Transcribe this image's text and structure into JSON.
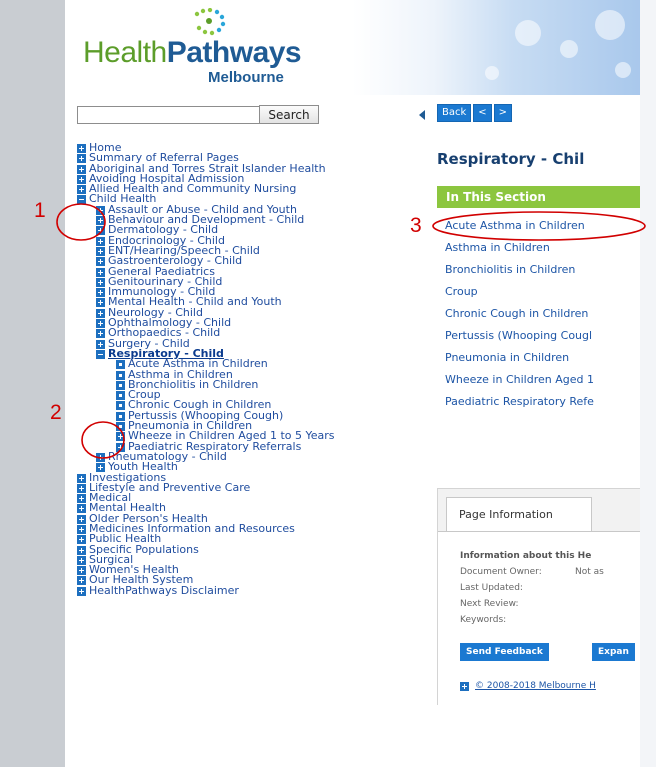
{
  "header": {
    "logo_health": "Health",
    "logo_pathways": "Pathways",
    "logo_region": "Melbourne"
  },
  "search": {
    "value": "",
    "button_label": "Search"
  },
  "nav_buttons": {
    "back": "Back",
    "prev": "<",
    "next": ">"
  },
  "tree": [
    {
      "label": "Home",
      "level": 1,
      "icon": "plus"
    },
    {
      "label": "Summary of Referral Pages",
      "level": 1,
      "icon": "plus"
    },
    {
      "label": "Aboriginal and Torres Strait Islander Health",
      "level": 1,
      "icon": "plus"
    },
    {
      "label": "Avoiding Hospital Admission",
      "level": 1,
      "icon": "plus"
    },
    {
      "label": "Allied Health and Community Nursing",
      "level": 1,
      "icon": "plus"
    },
    {
      "label": "Child Health",
      "level": 1,
      "icon": "minus"
    },
    {
      "label": "Assault or Abuse - Child and Youth",
      "level": 2,
      "icon": "plus"
    },
    {
      "label": "Behaviour and Development - Child",
      "level": 2,
      "icon": "plus"
    },
    {
      "label": "Dermatology - Child",
      "level": 2,
      "icon": "plus"
    },
    {
      "label": "Endocrinology - Child",
      "level": 2,
      "icon": "plus"
    },
    {
      "label": "ENT/Hearing/Speech - Child",
      "level": 2,
      "icon": "plus"
    },
    {
      "label": "Gastroenterology - Child",
      "level": 2,
      "icon": "plus"
    },
    {
      "label": "General Paediatrics",
      "level": 2,
      "icon": "plus"
    },
    {
      "label": "Genitourinary - Child",
      "level": 2,
      "icon": "plus"
    },
    {
      "label": "Immunology - Child",
      "level": 2,
      "icon": "plus"
    },
    {
      "label": "Mental Health - Child and Youth",
      "level": 2,
      "icon": "plus"
    },
    {
      "label": "Neurology - Child",
      "level": 2,
      "icon": "plus"
    },
    {
      "label": "Ophthalmology - Child",
      "level": 2,
      "icon": "plus"
    },
    {
      "label": "Orthopaedics - Child",
      "level": 2,
      "icon": "plus"
    },
    {
      "label": "Surgery - Child",
      "level": 2,
      "icon": "plus"
    },
    {
      "label": "Respiratory - Child",
      "level": 2,
      "icon": "minus",
      "current": true
    },
    {
      "label": "Acute Asthma in Children",
      "level": 3,
      "icon": "leaf"
    },
    {
      "label": "Asthma in Children",
      "level": 3,
      "icon": "leaf"
    },
    {
      "label": "Bronchiolitis in Children",
      "level": 3,
      "icon": "leaf"
    },
    {
      "label": "Croup",
      "level": 3,
      "icon": "leaf"
    },
    {
      "label": "Chronic Cough in Children",
      "level": 3,
      "icon": "leaf"
    },
    {
      "label": "Pertussis (Whooping Cough)",
      "level": 3,
      "icon": "leaf"
    },
    {
      "label": "Pneumonia in Children",
      "level": 3,
      "icon": "leaf"
    },
    {
      "label": "Wheeze in Children Aged 1 to 5 Years",
      "level": 3,
      "icon": "plus"
    },
    {
      "label": "Paediatric Respiratory Referrals",
      "level": 3,
      "icon": "plus"
    },
    {
      "label": "Rheumatology - Child",
      "level": 2,
      "icon": "plus"
    },
    {
      "label": "Youth Health",
      "level": 2,
      "icon": "plus"
    },
    {
      "label": "Investigations",
      "level": 1,
      "icon": "plus"
    },
    {
      "label": "Lifestyle and Preventive Care",
      "level": 1,
      "icon": "plus"
    },
    {
      "label": "Medical",
      "level": 1,
      "icon": "plus"
    },
    {
      "label": "Mental Health",
      "level": 1,
      "icon": "plus"
    },
    {
      "label": "Older Person's Health",
      "level": 1,
      "icon": "plus"
    },
    {
      "label": "Medicines Information and Resources",
      "level": 1,
      "icon": "plus"
    },
    {
      "label": "Public Health",
      "level": 1,
      "icon": "plus"
    },
    {
      "label": "Specific Populations",
      "level": 1,
      "icon": "plus"
    },
    {
      "label": "Surgical",
      "level": 1,
      "icon": "plus"
    },
    {
      "label": "Women's Health",
      "level": 1,
      "icon": "plus"
    },
    {
      "label": "Our Health System",
      "level": 1,
      "icon": "plus"
    },
    {
      "label": "HealthPathways Disclaimer",
      "level": 1,
      "icon": "plus"
    }
  ],
  "content": {
    "title": "Respiratory - Chil",
    "section_heading": "In This Section",
    "section_links": [
      "Acute Asthma in Children",
      "Asthma in Children",
      "Bronchiolitis in Children",
      "Croup",
      "Chronic Cough in Children",
      "Pertussis (Whooping Cougl",
      "Pneumonia in Children",
      "Wheeze in Children Aged 1",
      "Paediatric Respiratory Refe"
    ]
  },
  "page_info": {
    "tab_label": "Page Information",
    "heading": "Information about this He",
    "rows": [
      {
        "label": "Document Owner:",
        "value": "Not as"
      },
      {
        "label": "Last Updated:",
        "value": ""
      },
      {
        "label": "Next Review:",
        "value": ""
      },
      {
        "label": "Keywords:",
        "value": ""
      }
    ],
    "send_feedback": "Send Feedback",
    "expand": "Expan",
    "copyright": "© 2008-2018 Melbourne H"
  },
  "annotations": {
    "label_1": "1",
    "label_2": "2",
    "label_3": "3",
    "color": "#d10000"
  },
  "colors": {
    "brand_green": "#5c9d2a",
    "brand_blue": "#1f5b94",
    "link_blue": "#1f4c9e",
    "section_bar_green": "#8cc63f",
    "button_blue": "#1b79d1"
  }
}
